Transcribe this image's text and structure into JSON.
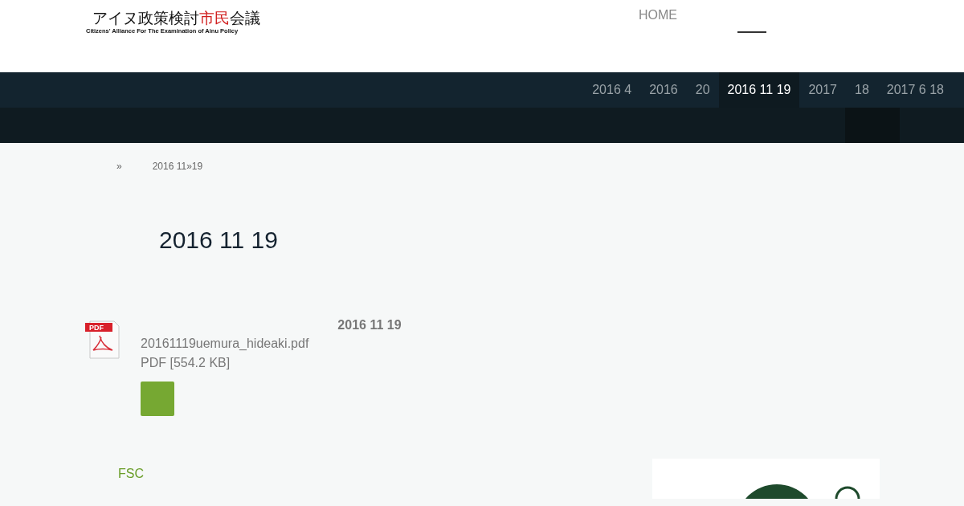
{
  "logo": {
    "title_parts": [
      {
        "text": "アイヌ政策検討",
        "accent": false
      },
      {
        "text": "市民",
        "accent": true
      },
      {
        "text": "会議",
        "accent": false
      }
    ],
    "subtitle": "Citizens' Alliance For The Examination of Ainu Policy"
  },
  "top_nav": [
    {
      "label": "HOME",
      "selected": false
    }
  ],
  "sub_nav": [
    {
      "label": "2016 4",
      "selected": false
    },
    {
      "label": "2016",
      "selected": false
    },
    {
      "label": "20",
      "selected": false
    },
    {
      "label": "2016 11 19",
      "selected": true
    },
    {
      "label": "2017",
      "selected": false
    },
    {
      "label": "18",
      "selected": false
    },
    {
      "label": "2017 6 18",
      "selected": false
    }
  ],
  "breadcrumb": [
    "»",
    "2016 11»19"
  ],
  "page_title": "2016 11 19",
  "download": {
    "icon_label": "PDF",
    "filename": "20161119uemura_hideaki.pdf",
    "meta": "PDF [554.2 KB]",
    "date": "2016 11 19"
  },
  "footer_link": "FSC"
}
